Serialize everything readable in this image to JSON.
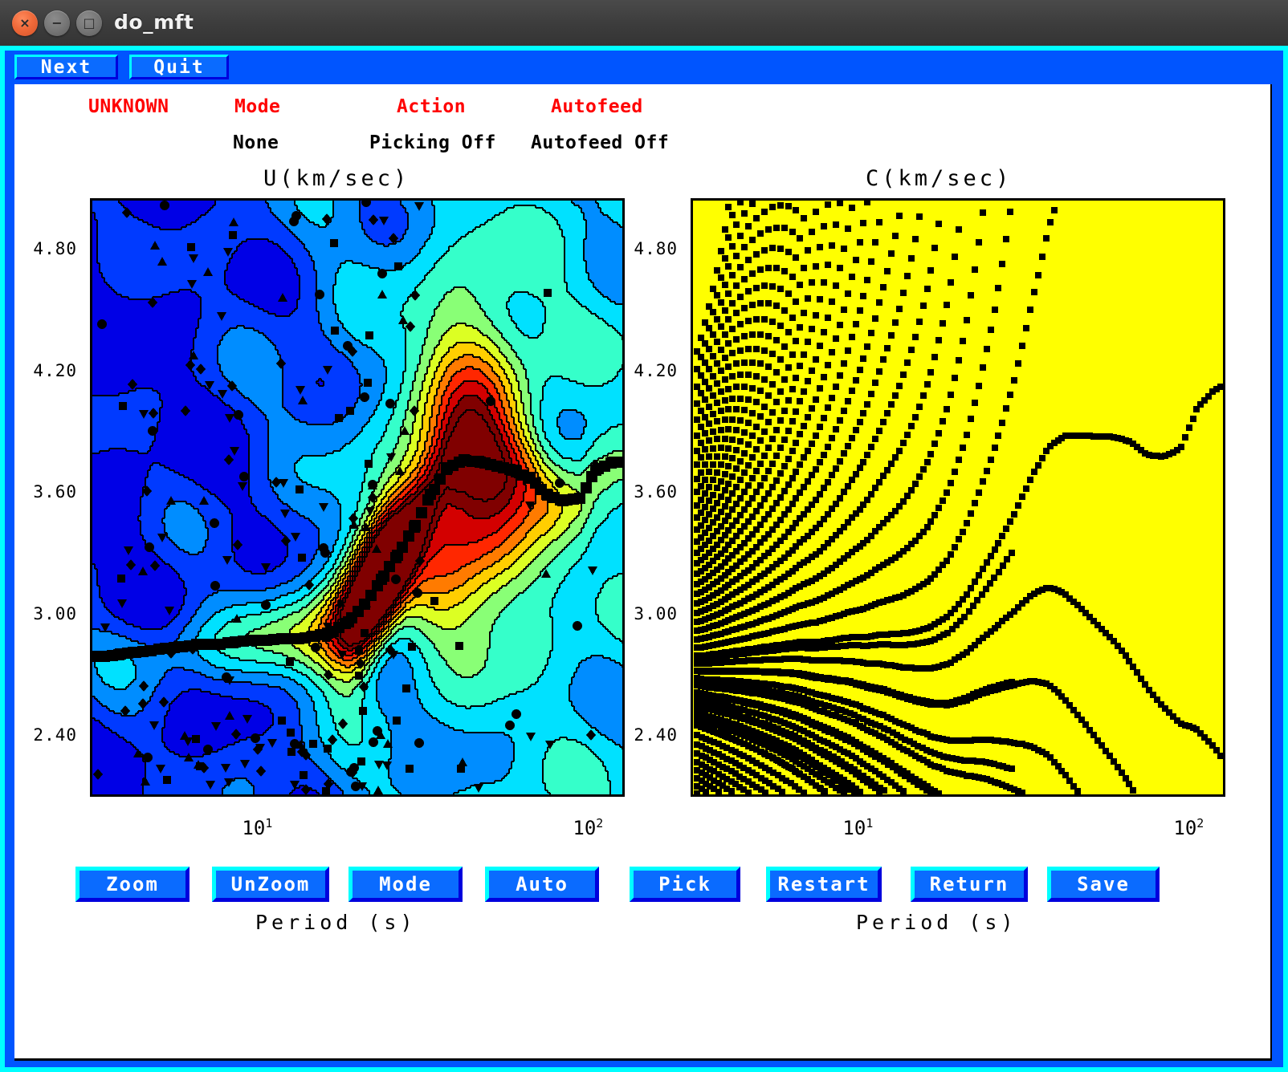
{
  "window": {
    "title": "do_mft",
    "controls": [
      {
        "name": "close-button",
        "glyph": "×"
      },
      {
        "name": "minimize-button",
        "glyph": "−"
      },
      {
        "name": "maximize-button",
        "glyph": "□"
      }
    ]
  },
  "toolbar": {
    "next_label": "Next",
    "quit_label": "Quit"
  },
  "status": {
    "headers": {
      "file": "UNKNOWN",
      "mode": "Mode",
      "action": "Action",
      "autofeed": "Autofeed"
    },
    "values": {
      "mode": "None",
      "action": "Picking Off",
      "autofeed": "Autofeed Off"
    }
  },
  "colors": {
    "frame_outer": "#00ffff",
    "frame_inner": "#0055ff",
    "button_face": "#0a6bff",
    "button_highlight": "#00ffff",
    "button_shadow": "#0000dd",
    "header_text": "#ff0000",
    "value_text": "#000000",
    "plot_c_background": "#ffff00",
    "marker": "#000000"
  },
  "actions": [
    {
      "name": "zoom",
      "label": "Zoom"
    },
    {
      "name": "unzoom",
      "label": "UnZoom"
    },
    {
      "name": "mode",
      "label": "Mode"
    },
    {
      "name": "auto",
      "label": "Auto"
    },
    {
      "name": "pick",
      "label": "Pick"
    },
    {
      "name": "restart",
      "label": "Restart"
    },
    {
      "name": "return",
      "label": "Return"
    },
    {
      "name": "save",
      "label": "Save"
    }
  ],
  "chart_data": [
    {
      "id": "group-velocity",
      "type": "heatmap",
      "title": "U(km/sec)",
      "xlabel": "Period (s)",
      "ylabel": "",
      "xscale": "log",
      "xlim": [
        3.0,
        120.0
      ],
      "ylim": [
        2.12,
        5.05
      ],
      "xticks_major": [
        10,
        100
      ],
      "xticklabels_major": [
        "10",
        "100"
      ],
      "yticks_major": [
        4.8,
        4.2,
        3.6,
        3.0,
        2.4
      ],
      "yticklabels": [
        "4.80",
        "4.20",
        "3.60",
        "3.00",
        "2.40"
      ],
      "colormap": "jet",
      "grid": false,
      "legend": false,
      "description": "Multiple filter technique group velocity amplitude contour map; warm colors mark the energy maximum ridge near 18-25 s period at ~2.9-3.1 km/sec.",
      "contour_levels": [
        0.05,
        0.1,
        0.2,
        0.3,
        0.4,
        0.5,
        0.6,
        0.7,
        0.8,
        0.9,
        1.0
      ],
      "picked_dispersion": {
        "name": "picked group velocity",
        "marker": "square",
        "x": [
          3.2,
          3.6,
          4.0,
          4.5,
          5.0,
          5.6,
          6.3,
          7.1,
          8.0,
          9.0,
          10.0,
          11.2,
          12.6,
          14.1,
          15.8,
          17.8,
          20.0,
          22.4,
          25.1,
          28.2,
          31.6,
          35.5,
          39.8,
          44.7,
          50.1,
          56.2,
          63.1,
          70.8,
          79.4,
          89.1,
          100.0,
          112.0
        ],
        "y": [
          2.8,
          2.81,
          2.82,
          2.83,
          2.84,
          2.85,
          2.86,
          2.86,
          2.87,
          2.88,
          2.88,
          2.89,
          2.89,
          2.9,
          2.92,
          2.97,
          3.06,
          3.18,
          3.3,
          3.44,
          3.6,
          3.73,
          3.77,
          3.76,
          3.74,
          3.72,
          3.68,
          3.6,
          3.57,
          3.58,
          3.72,
          3.76
        ]
      },
      "noise_markers": {
        "name": "secondary spectral maxima",
        "symbols": [
          "square",
          "triangle-up",
          "triangle-down",
          "diamond",
          "circle"
        ],
        "count": 220
      }
    },
    {
      "id": "phase-velocity",
      "type": "scatter",
      "title": "C(km/sec)",
      "xlabel": "Period (s)",
      "ylabel": "",
      "xscale": "log",
      "xlim": [
        3.0,
        120.0
      ],
      "ylim": [
        2.12,
        5.05
      ],
      "xticks_major": [
        10,
        100
      ],
      "xticklabels_major": [
        "10",
        "100"
      ],
      "yticks_major": [
        4.8,
        4.2,
        3.6,
        3.0,
        2.4
      ],
      "yticklabels": [
        "4.80",
        "4.20",
        "3.60",
        "3.00",
        "2.40"
      ],
      "background": "#ffff00",
      "grid": false,
      "legend": false,
      "description": "Phase velocity 2-pi ambiguity fan: families of candidate phase velocity branches plotted as black square dots over a yellow field.",
      "branch_count": 26,
      "marker": "square",
      "marker_color": "#000000"
    }
  ]
}
